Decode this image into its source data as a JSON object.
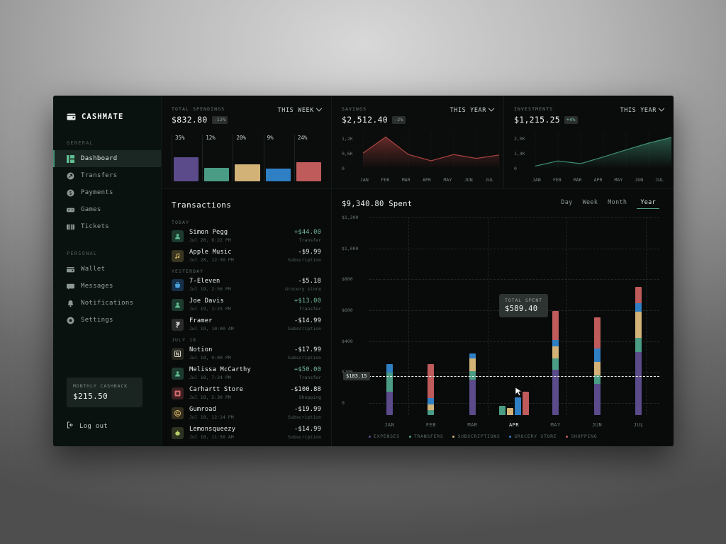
{
  "brand": {
    "name": "CASHMATE",
    "icon": "wallet-icon"
  },
  "sidebar": {
    "general_label": "GENERAL",
    "personal_label": "PERSONAL",
    "general": [
      {
        "label": "Dashboard",
        "icon": "dashboard-icon",
        "active": true
      },
      {
        "label": "Transfers",
        "icon": "transfers-icon",
        "active": false
      },
      {
        "label": "Payments",
        "icon": "payments-icon",
        "active": false
      },
      {
        "label": "Games",
        "icon": "games-icon",
        "active": false
      },
      {
        "label": "Tickets",
        "icon": "tickets-icon",
        "active": false
      }
    ],
    "personal": [
      {
        "label": "Wallet",
        "icon": "wallet-icon",
        "active": false
      },
      {
        "label": "Messages",
        "icon": "messages-icon",
        "active": false
      },
      {
        "label": "Notifications",
        "icon": "bell-icon",
        "active": false
      },
      {
        "label": "Settings",
        "icon": "gear-icon",
        "active": false
      }
    ],
    "cashback": {
      "label": "MONTHLY CASHBACK",
      "value": "$215.50"
    },
    "logout": {
      "label": "Log out",
      "icon": "logout-icon"
    }
  },
  "cards": {
    "spendings": {
      "label": "TOTAL SPENDINGS",
      "value": "$832.80",
      "badge": "-12%",
      "period": "THIS WEEK",
      "bars": [
        {
          "pct_label": "35%",
          "pct": 35,
          "color": "#5b4b8a"
        },
        {
          "pct_label": "12%",
          "pct": 12,
          "color": "#4a9c85"
        },
        {
          "pct_label": "20%",
          "pct": 20,
          "color": "#d3b277"
        },
        {
          "pct_label": "9%",
          "pct": 9,
          "color": "#2f7fc4"
        },
        {
          "pct_label": "24%",
          "pct": 24,
          "color": "#bf5b5b"
        }
      ]
    },
    "savings": {
      "label": "SAVINGS",
      "value": "$2,512.40",
      "badge": "-2%",
      "period": "THIS YEAR",
      "color": "#a8433f",
      "chart_data": {
        "type": "area",
        "title": "Savings",
        "categories": [
          "JAN",
          "FEB",
          "MAR",
          "APR",
          "MAY",
          "JUN",
          "JUL"
        ],
        "values": [
          640,
          1300,
          580,
          320,
          580,
          420,
          560
        ],
        "yticks": [
          "0",
          "0,6K",
          "1,2K"
        ],
        "ylim": [
          0,
          1400
        ]
      }
    },
    "investments": {
      "label": "INVESTMENTS",
      "value": "$1,215.25",
      "badge": "+4%",
      "period": "THIS YEAR",
      "color": "#3f8f75",
      "chart_data": {
        "type": "area",
        "title": "Investments",
        "categories": [
          "JAN",
          "FEB",
          "MAR",
          "APR",
          "MAY",
          "JUN",
          "JUL"
        ],
        "values": [
          180,
          540,
          350,
          820,
          1320,
          1800,
          2200
        ],
        "yticks": [
          "0",
          "1,4K",
          "2,0K"
        ],
        "ylim": [
          0,
          2400
        ]
      }
    }
  },
  "transactions": {
    "title": "Transactions",
    "groups": [
      {
        "day": "TODAY",
        "items": [
          {
            "name": "Simon Pegg",
            "date": "Jul 20, 6:22 PM",
            "amount": "+$44.00",
            "positive": true,
            "category": "Transfer",
            "icon": "person-icon",
            "icon_bg": "#1d3a2f",
            "icon_fg": "#5fbf92"
          },
          {
            "name": "Apple Music",
            "date": "Jul 20, 12:30 PM",
            "amount": "-$9.99",
            "positive": false,
            "category": "Subscription",
            "icon": "music-icon",
            "icon_bg": "#3a3520",
            "icon_fg": "#ddc06a"
          }
        ]
      },
      {
        "day": "YESTERDAY",
        "items": [
          {
            "name": "7-Eleven",
            "date": "Jul 19, 2:56 PM",
            "amount": "-$5.18",
            "positive": false,
            "category": "Grocery store",
            "icon": "bag-icon",
            "icon_bg": "#16304a",
            "icon_fg": "#4aa3e0"
          },
          {
            "name": "Joe Davis",
            "date": "Jul 19, 1:23 PM",
            "amount": "+$13.00",
            "positive": true,
            "category": "Transfer",
            "icon": "person-icon",
            "icon_bg": "#1d3a2f",
            "icon_fg": "#5fbf92"
          },
          {
            "name": "Framer",
            "date": "Jul 19, 10:00 AM",
            "amount": "-$14.99",
            "positive": false,
            "category": "Subscription",
            "icon": "framer-icon",
            "icon_bg": "#2a2a2a",
            "icon_fg": "#c9c9c9"
          }
        ]
      },
      {
        "day": "JULY 18",
        "items": [
          {
            "name": "Notion",
            "date": "Jul 18, 9:00 PM",
            "amount": "-$17.99",
            "positive": false,
            "category": "Subscription",
            "icon": "notion-icon",
            "icon_bg": "#26261f",
            "icon_fg": "#d6d2c4"
          },
          {
            "name": "Melissa McCarthy",
            "date": "Jul 18, 7:24 PM",
            "amount": "+$50.00",
            "positive": true,
            "category": "Transfer",
            "icon": "person-icon",
            "icon_bg": "#1d3a2f",
            "icon_fg": "#5fbf92"
          },
          {
            "name": "Carhartt Store",
            "date": "Jul 18, 5:30 PM",
            "amount": "-$100.88",
            "positive": false,
            "category": "Shopping",
            "icon": "store-icon",
            "icon_bg": "#3b1f22",
            "icon_fg": "#d96b6b"
          },
          {
            "name": "Gumroad",
            "date": "Jul 18, 12:14 PM",
            "amount": "-$19.99",
            "positive": false,
            "category": "Subscription",
            "icon": "gumroad-icon",
            "icon_bg": "#332d1d",
            "icon_fg": "#d9bb6a"
          },
          {
            "name": "Lemonsqueezy",
            "date": "Jul 18, 11:56 AM",
            "amount": "-$14.99",
            "positive": false,
            "category": "Subscription",
            "icon": "lemon-icon",
            "icon_bg": "#2d3320",
            "icon_fg": "#b9cf6a"
          }
        ]
      }
    ]
  },
  "main": {
    "title": "$9,340.80 Spent",
    "tabs": [
      {
        "label": "Day",
        "active": false
      },
      {
        "label": "Week",
        "active": false
      },
      {
        "label": "Month",
        "active": false
      },
      {
        "label": "Year",
        "active": true
      }
    ],
    "tooltip": {
      "label": "TOTAL SPENT",
      "value": "$589.40"
    },
    "average_label": "$183.15",
    "hovered_category": "APR",
    "chart_data": {
      "type": "bar",
      "stacked": true,
      "title": "$9,340.80 Spent",
      "xlabel": "",
      "ylabel": "",
      "categories": [
        "JAN",
        "FEB",
        "MAR",
        "APR",
        "MAY",
        "JUN",
        "JUL"
      ],
      "yticks": [
        "0",
        "$200",
        "$400",
        "$600",
        "$800",
        "$1,000",
        "$1,200"
      ],
      "ylim": [
        0,
        1260
      ],
      "grid": true,
      "average_line": 183.15,
      "legend_position": "bottom",
      "series": [
        {
          "name": "EXPENSES",
          "color": "#5b4b8a",
          "values": [
            160,
            0,
            240,
            0,
            310,
            210,
            430
          ]
        },
        {
          "name": "TRANSFERS",
          "color": "#4a9c85",
          "values": [
            130,
            35,
            60,
            62,
            75,
            60,
            95
          ]
        },
        {
          "name": "SUBSCRIPTIONS",
          "color": "#d3b277",
          "values": [
            0,
            35,
            85,
            50,
            80,
            90,
            175
          ]
        },
        {
          "name": "GROCERY STORE",
          "color": "#2f7fc4",
          "values": [
            55,
            45,
            35,
            118,
            45,
            90,
            60
          ]
        },
        {
          "name": "SHOPPING",
          "color": "#bf5b5b",
          "values": [
            0,
            230,
            0,
            160,
            195,
            215,
            110
          ]
        }
      ]
    },
    "legend": [
      "EXPENSES",
      "TRANSFERS",
      "SUBSCRIPTIONS",
      "GROCERY STORE",
      "SHOPPING"
    ]
  }
}
